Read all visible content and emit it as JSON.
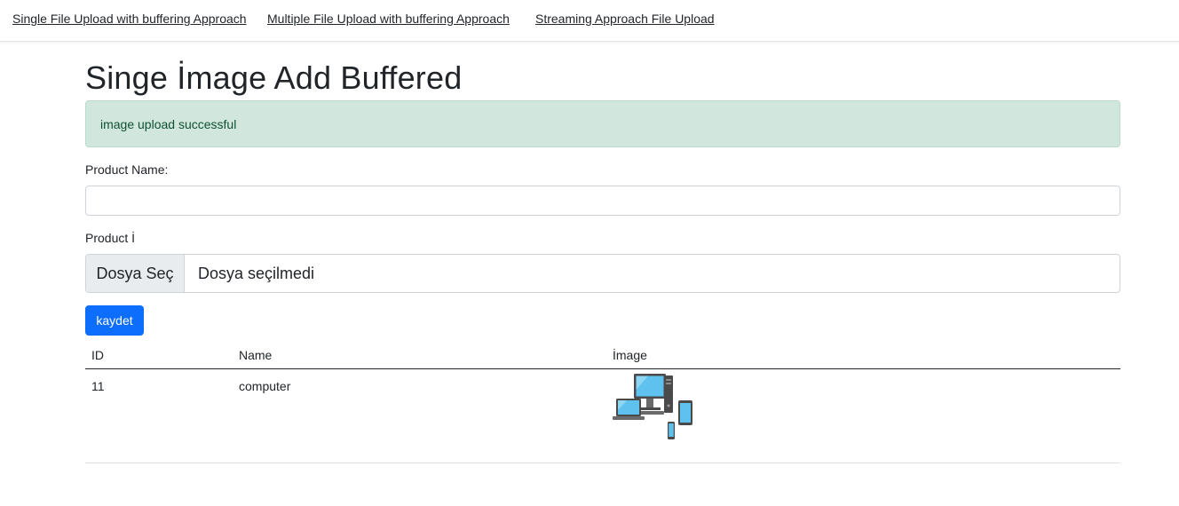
{
  "nav": {
    "links": [
      "Single File Upload with buffering Approach",
      "Multiple File Upload with buffering Approach",
      "Streaming Approach File Upload"
    ]
  },
  "page": {
    "title": "Singe İmage Add Buffered",
    "alert_message": "image upload successful"
  },
  "form": {
    "product_name_label": "Product Name:",
    "product_name_value": "",
    "product_image_label": "Product İ",
    "file_button_label": "Dosya Seç",
    "file_status": "Dosya seçilmedi",
    "submit_label": "kaydet"
  },
  "table": {
    "headers": [
      "ID",
      "Name",
      "İmage"
    ],
    "rows": [
      {
        "id": "11",
        "name": "computer",
        "image_icon": "devices-icon"
      }
    ]
  },
  "colors": {
    "alert_bg": "#d1e7dd",
    "alert_text": "#0f5132",
    "primary": "#0d6efd"
  }
}
